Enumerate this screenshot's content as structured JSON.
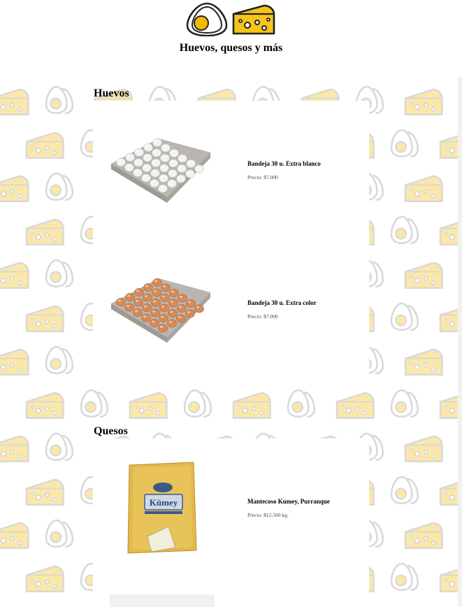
{
  "site": {
    "title": "Huevos, quesos y más",
    "logo_icons": [
      "egg-icon",
      "cheese-icon"
    ]
  },
  "colors": {
    "pattern_gray": "#d9d9d9",
    "cheese_fill": "#fbe8a8",
    "cheese_logo": "#f5c518",
    "egg_yolk": "#f5b800"
  },
  "sections": [
    {
      "title": "Huevos",
      "products": [
        {
          "name": "Bandeja 30 u. Extra blanco",
          "price": "Precio: $7.000",
          "image": "white-eggs-tray"
        },
        {
          "name": "Bandeja 30 u. Extra color",
          "price": "Precio: $7.000",
          "image": "brown-eggs-tray"
        }
      ]
    },
    {
      "title": "Quesos",
      "products": [
        {
          "name": "Mantecoso Kumey, Purranque",
          "price": "Precio: $12.500 kg.",
          "image": "kumey-cheese",
          "brand": "Kümey"
        }
      ]
    }
  ]
}
